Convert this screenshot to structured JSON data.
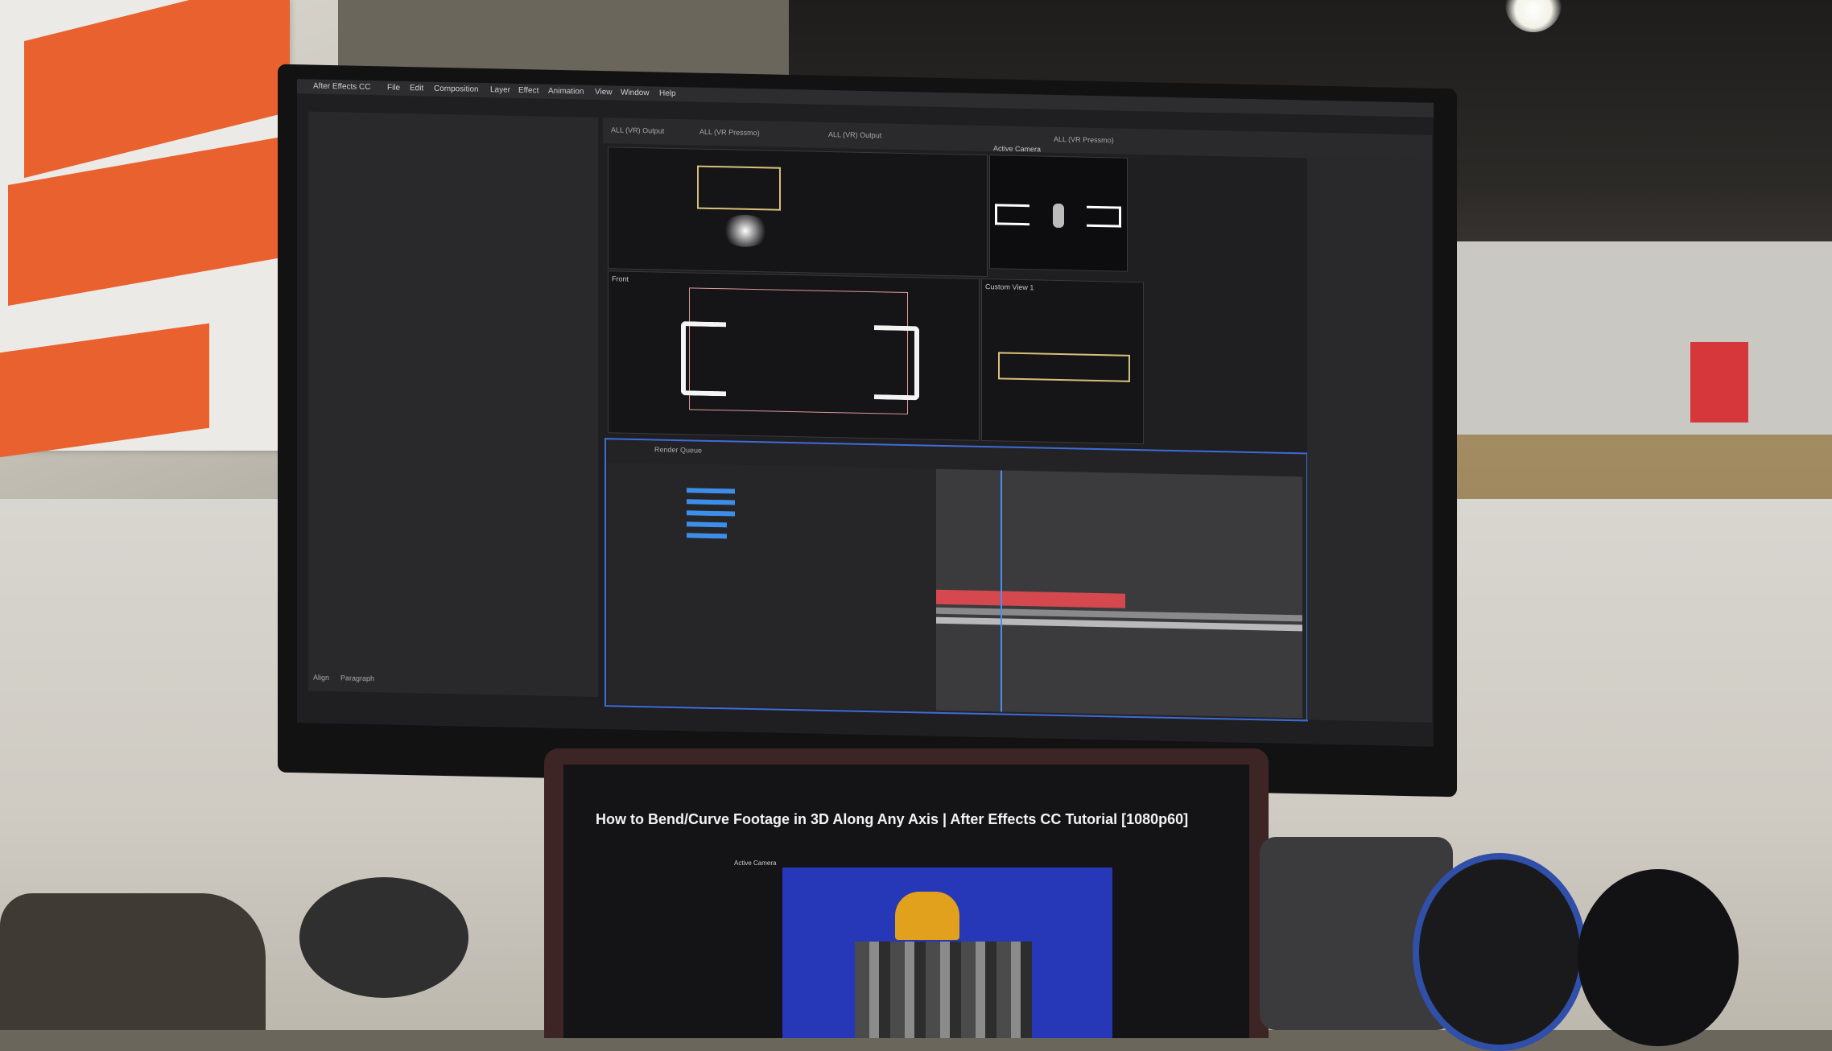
{
  "monitor": {
    "menu": [
      "After Effects CC",
      "File",
      "Edit",
      "Composition",
      "Layer",
      "Effect",
      "Animation",
      "View",
      "Window",
      "Help"
    ],
    "tabs": [
      "ALL (VR) Output",
      "ALL (VR Pressmo)",
      "ALL (VR) Output",
      "ALL (VR Pressmo)"
    ],
    "view_labels": {
      "active_camera": "Active Camera",
      "front": "Front",
      "custom_view": "Custom View 1"
    },
    "panels": {
      "render_queue": "Render Queue",
      "align": "Align",
      "paragraph": "Paragraph"
    }
  },
  "laptop": {
    "video_title": "How to Bend/Curve Footage in 3D Along Any Axis | After Effects CC Tutorial [1080p60]",
    "frame_active_camera": "Active Camera"
  },
  "colors": {
    "ui_background": "#1f1f21",
    "timeline_border": "#3d6bd8",
    "video_blue": "#2637b8",
    "poster_orange": "#e9612e"
  }
}
